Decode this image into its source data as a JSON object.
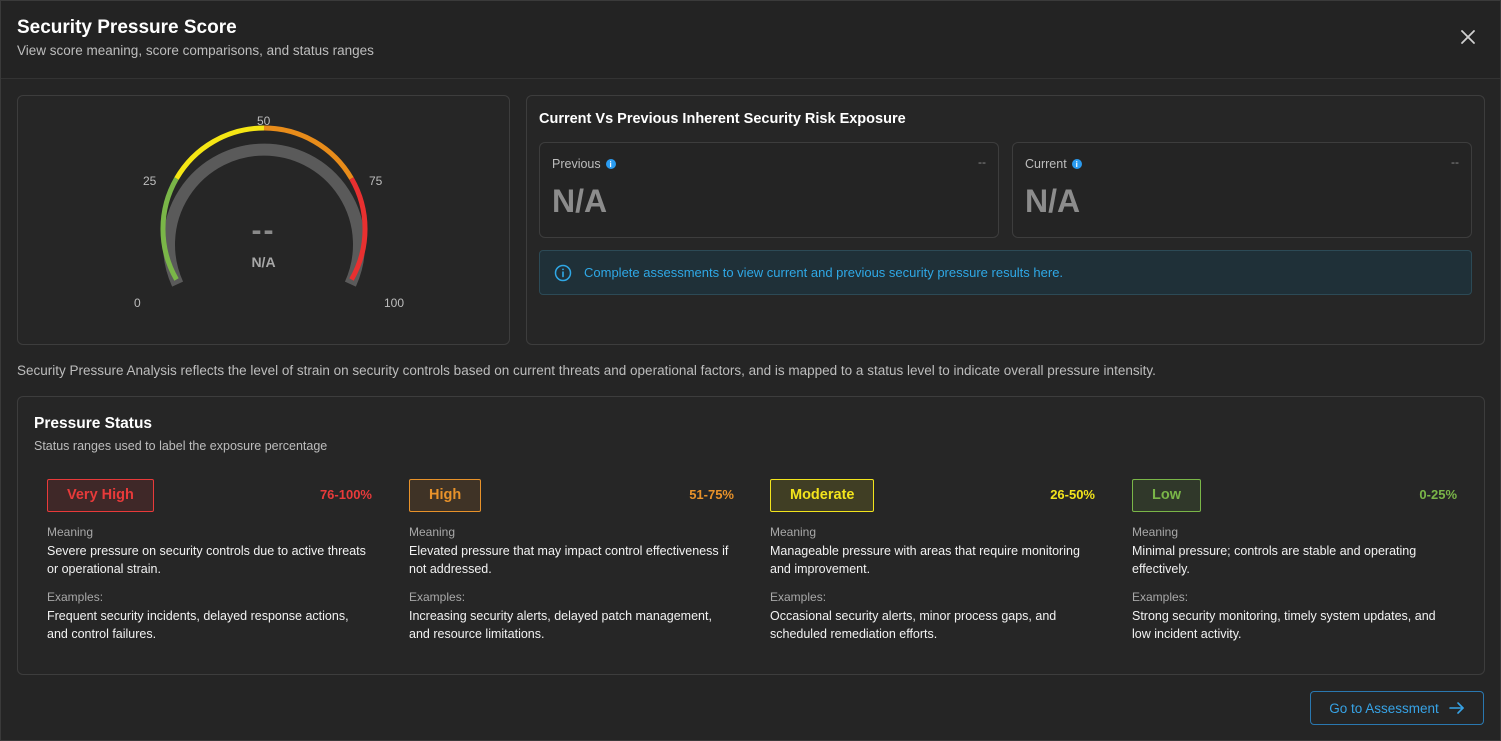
{
  "header": {
    "title": "Security Pressure Score",
    "subtitle": "View score meaning, score comparisons, and status ranges",
    "close_icon": "close-icon"
  },
  "gauge": {
    "value_display": "--",
    "status": "N/A",
    "ticks": [
      "0",
      "25",
      "50",
      "75",
      "100"
    ],
    "segment_colors": [
      "#7ab648",
      "#f5e614",
      "#e88c1a",
      "#e83030"
    ]
  },
  "comparison": {
    "title": "Current Vs Previous Inherent Security Risk Exposure",
    "previous": {
      "label": "Previous",
      "value": "N/A",
      "change": "--"
    },
    "current": {
      "label": "Current",
      "value": "N/A",
      "change": "--"
    },
    "notice": "Complete assessments to view current and previous security pressure results here."
  },
  "description": "Security Pressure Analysis reflects the level of strain on security controls based on current threats and operational factors, and is mapped to a status level to indicate overall pressure intensity.",
  "pressure_status": {
    "title": "Pressure Status",
    "subtitle": "Status ranges used to label the exposure percentage",
    "meaning_label": "Meaning",
    "examples_label": "Examples:",
    "levels": [
      {
        "name": "Very High",
        "range": "76-100%",
        "color": "#e83a3a",
        "meaning": "Severe pressure on security controls due to active threats or operational strain.",
        "examples": "Frequent security incidents, delayed response actions, and control failures."
      },
      {
        "name": "High",
        "range": "51-75%",
        "color": "#e8922a",
        "meaning": "Elevated pressure that may impact control effectiveness if not addressed.",
        "examples": "Increasing security alerts, delayed patch management, and resource limitations."
      },
      {
        "name": "Moderate",
        "range": "26-50%",
        "color": "#f2e41c",
        "meaning": "Manageable pressure with areas that require monitoring and improvement.",
        "examples": "Occasional security alerts, minor process gaps, and scheduled remediation efforts."
      },
      {
        "name": "Low",
        "range": "0-25%",
        "color": "#7ab648",
        "meaning": "Minimal pressure; controls are stable and operating effectively.",
        "examples": "Strong security monitoring, timely system updates, and low incident activity."
      }
    ]
  },
  "footer": {
    "go_button": "Go to Assessment"
  }
}
